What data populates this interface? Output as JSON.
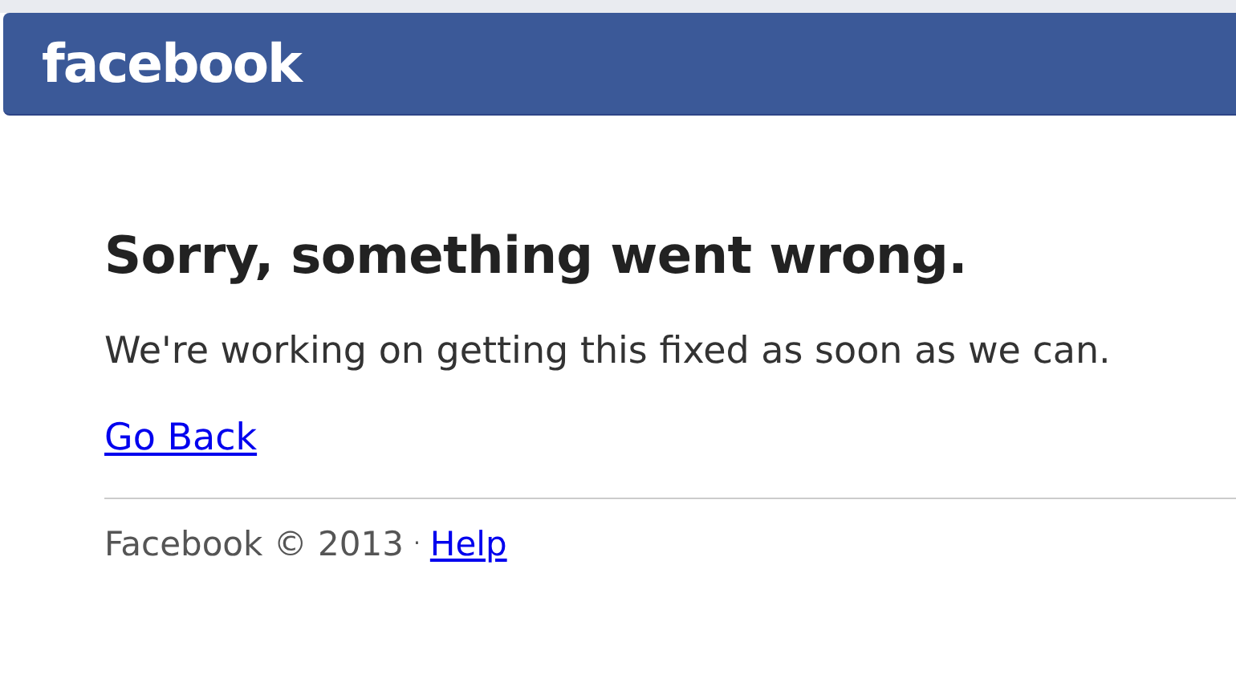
{
  "header": {
    "logo": "facebook"
  },
  "error": {
    "title": "Sorry, something went wrong.",
    "message": "We're working on getting this fixed as soon as we can.",
    "link": "Go Back"
  },
  "footer": {
    "copyright": "Facebook © 2013",
    "separator": "·",
    "link": "Help"
  }
}
